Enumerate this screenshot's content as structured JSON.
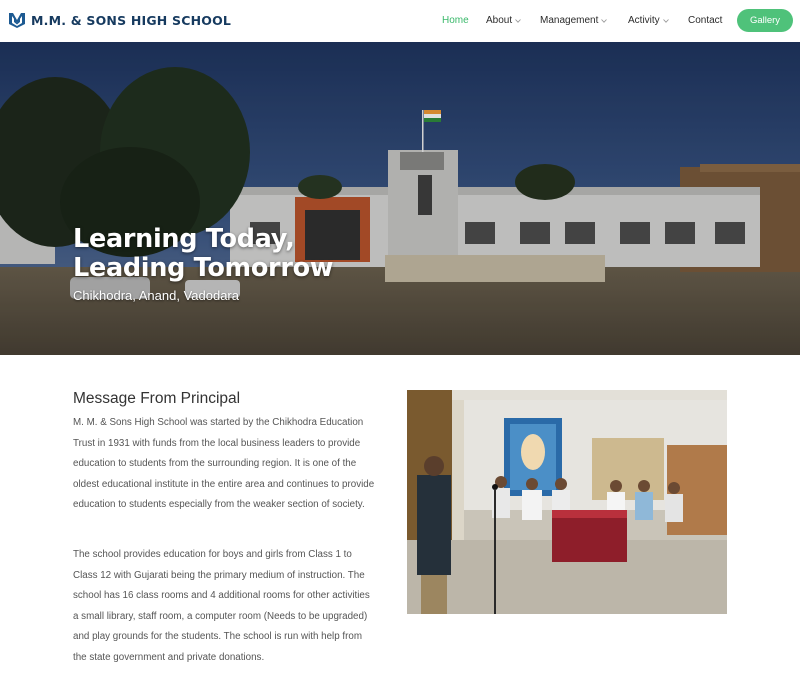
{
  "brand": {
    "name": "M.M. & SONS HIGH SCHOOL",
    "logo_icon": "shield-logo-icon",
    "color": "#163a5f"
  },
  "nav": {
    "items": [
      {
        "label": "Home",
        "active": true,
        "dropdown": false
      },
      {
        "label": "About",
        "active": false,
        "dropdown": true
      },
      {
        "label": "Management",
        "active": false,
        "dropdown": true
      },
      {
        "label": "Activity",
        "active": false,
        "dropdown": true
      },
      {
        "label": "Contact",
        "active": false,
        "dropdown": false
      }
    ],
    "cta_label": "Gallery",
    "accent_color": "#4fc27a"
  },
  "hero": {
    "title_line1": "Learning Today,",
    "title_line2": "Leading Tomorrow",
    "subtitle": "Chikhodra, Anand, Vadodara"
  },
  "principal": {
    "heading": "Message From Principal",
    "paragraph1": "M. M. & Sons High School was started by the Chikhodra Education Trust in 1931 with funds from the local business leaders to provide education to students from the surrounding region. It is one of the oldest educational institute in the entire area and continues to provide education to students especially from the weaker section of society.",
    "paragraph2": "The school provides education for boys and girls from Class 1 to Class 12 with Gujarati being the primary medium of instruction. The school has 16 class rooms and 4 additional rooms for other activities a small library, staff room, a computer room (Needs to be upgraded) and play grounds for the students. The school is run with help from the state government and private donations."
  }
}
